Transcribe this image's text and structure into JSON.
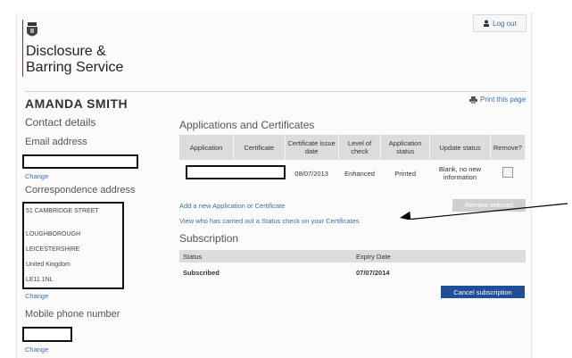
{
  "header": {
    "org_line1": "Disclosure &",
    "org_line2": "Barring Service",
    "logout_label": "Log out",
    "print_label": "Print this page"
  },
  "user": {
    "name": "AMANDA SMITH"
  },
  "sidebar": {
    "contact_heading": "Contact details",
    "email_heading": "Email address",
    "email_change": "Change",
    "correspondence_heading": "Correspondence address",
    "address_lines": [
      "51 CAMBRIDGE STREET",
      "",
      "LOUGHBOROUGH",
      "LEICESTERSHIRE",
      "United Kingdom",
      "LE11 1NL"
    ],
    "address_change": "Change",
    "mobile_heading": "Mobile phone number",
    "mobile_change": "Change"
  },
  "applications": {
    "heading": "Applications and Certificates",
    "columns": [
      "Application",
      "Certificate",
      "Certificate issue date",
      "Level of check",
      "Application status",
      "Update status",
      "Remove?"
    ],
    "rows": [
      {
        "application": "",
        "certificate": "",
        "issue_date": "08/07/2013",
        "level": "Enhanced",
        "app_status": "Printed",
        "update_status": "Blank, no new information"
      }
    ],
    "add_link": "Add a new Application or Certificate",
    "status_check_link": "View who has carried out a Status check on your Certificates",
    "remove_button": "Remove selected"
  },
  "subscription": {
    "heading": "Subscription",
    "columns": [
      "Status",
      "Expiry Date"
    ],
    "status": "Subscribed",
    "expiry": "07/07/2014",
    "cancel_button": "Cancel subscription"
  },
  "colors": {
    "link": "#3a6fb0",
    "brand": "#6b2e63",
    "primary_button": "#1f4f96"
  },
  "icons": [
    "crest-icon",
    "user-icon",
    "printer-icon",
    "arrow-annotation-icon"
  ]
}
